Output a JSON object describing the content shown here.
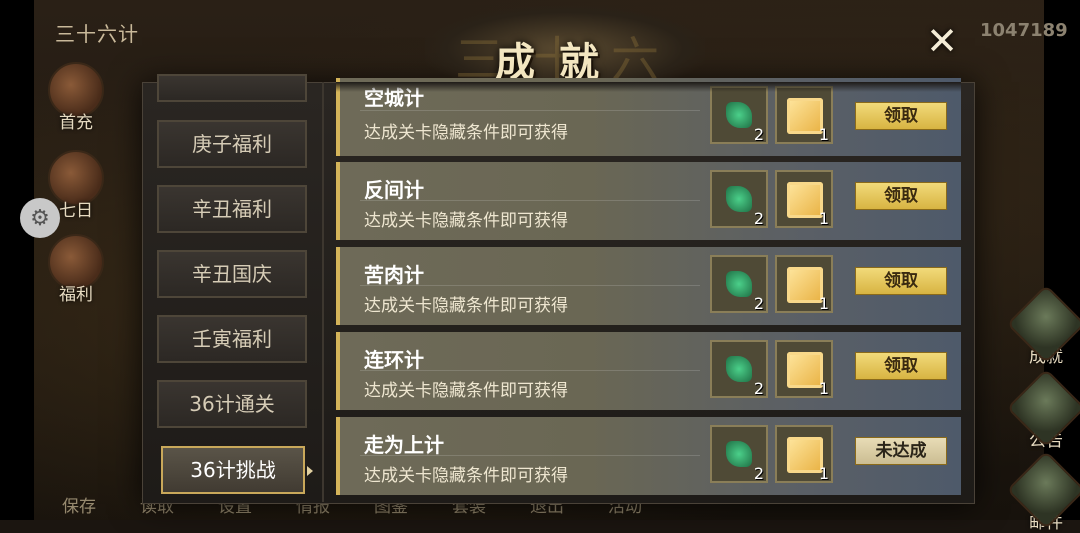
{
  "top_title": "三十六计",
  "score": "1047189",
  "modal_title": "成就",
  "modal_title_ghost": "三十六计",
  "close_label": "✕",
  "left_icons": [
    {
      "label": "首充"
    },
    {
      "label": "七日"
    },
    {
      "label": "福利"
    }
  ],
  "right_icons": [
    {
      "label": "成就"
    },
    {
      "label": "公告"
    },
    {
      "label": "邮件"
    }
  ],
  "bottom_menu": [
    "保存",
    "读取",
    "设置",
    "情报",
    "图鉴",
    "套装",
    "退出",
    "活动"
  ],
  "nav": {
    "items": [
      {
        "label": ""
      },
      {
        "label": "庚子福利"
      },
      {
        "label": "辛丑福利"
      },
      {
        "label": "辛丑国庆"
      },
      {
        "label": "壬寅福利"
      },
      {
        "label": "36计通关"
      },
      {
        "label": "36计挑战"
      }
    ],
    "active_index": 6
  },
  "achievements": [
    {
      "name": "空城计",
      "desc": "达成关卡隐藏条件即可获得",
      "rewards": [
        {
          "icon": "jade-icon",
          "count": "2"
        },
        {
          "icon": "scroll-icon",
          "count": "1"
        }
      ],
      "button": "领取",
      "claimable": true
    },
    {
      "name": "反间计",
      "desc": "达成关卡隐藏条件即可获得",
      "rewards": [
        {
          "icon": "jade-icon",
          "count": "2"
        },
        {
          "icon": "scroll-icon",
          "count": "1"
        }
      ],
      "button": "领取",
      "claimable": true
    },
    {
      "name": "苦肉计",
      "desc": "达成关卡隐藏条件即可获得",
      "rewards": [
        {
          "icon": "jade-icon",
          "count": "2"
        },
        {
          "icon": "scroll-icon",
          "count": "1"
        }
      ],
      "button": "领取",
      "claimable": true
    },
    {
      "name": "连环计",
      "desc": "达成关卡隐藏条件即可获得",
      "rewards": [
        {
          "icon": "jade-icon",
          "count": "2"
        },
        {
          "icon": "scroll-icon",
          "count": "1"
        }
      ],
      "button": "领取",
      "claimable": true
    },
    {
      "name": "走为上计",
      "desc": "达成关卡隐藏条件即可获得",
      "rewards": [
        {
          "icon": "jade-icon",
          "count": "2"
        },
        {
          "icon": "scroll-icon",
          "count": "1"
        }
      ],
      "button": "未达成",
      "claimable": false
    }
  ]
}
